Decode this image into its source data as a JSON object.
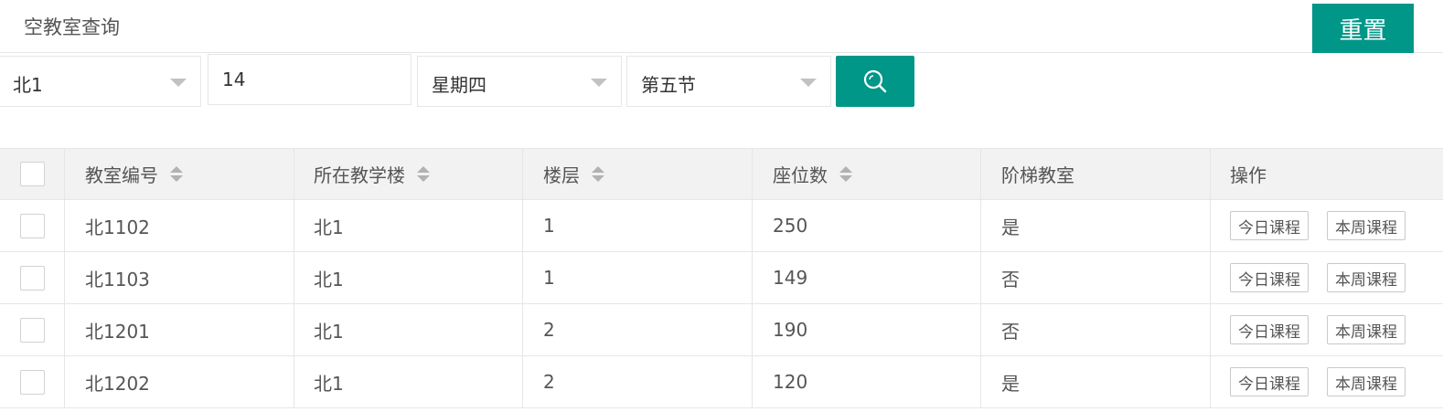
{
  "header": {
    "title": "空教室查询",
    "reset_label": "重置"
  },
  "filters": {
    "building": "北1",
    "week": "14",
    "weekday": "星期四",
    "period": "第五节",
    "search_icon": "search-icon"
  },
  "table": {
    "columns": [
      "教室编号",
      "所在教学楼",
      "楼层",
      "座位数",
      "阶梯教室",
      "操作"
    ],
    "rows": [
      {
        "room": "北1102",
        "building": "北1",
        "floor": "1",
        "seats": "250",
        "tiered": "是"
      },
      {
        "room": "北1103",
        "building": "北1",
        "floor": "1",
        "seats": "149",
        "tiered": "否"
      },
      {
        "room": "北1201",
        "building": "北1",
        "floor": "2",
        "seats": "190",
        "tiered": "否"
      },
      {
        "room": "北1202",
        "building": "北1",
        "floor": "2",
        "seats": "120",
        "tiered": "是"
      }
    ],
    "actions": {
      "today": "今日课程",
      "week": "本周课程"
    }
  },
  "colors": {
    "accent": "#009688",
    "header_bg": "#f2f2f2",
    "border": "#e6e6e6"
  }
}
